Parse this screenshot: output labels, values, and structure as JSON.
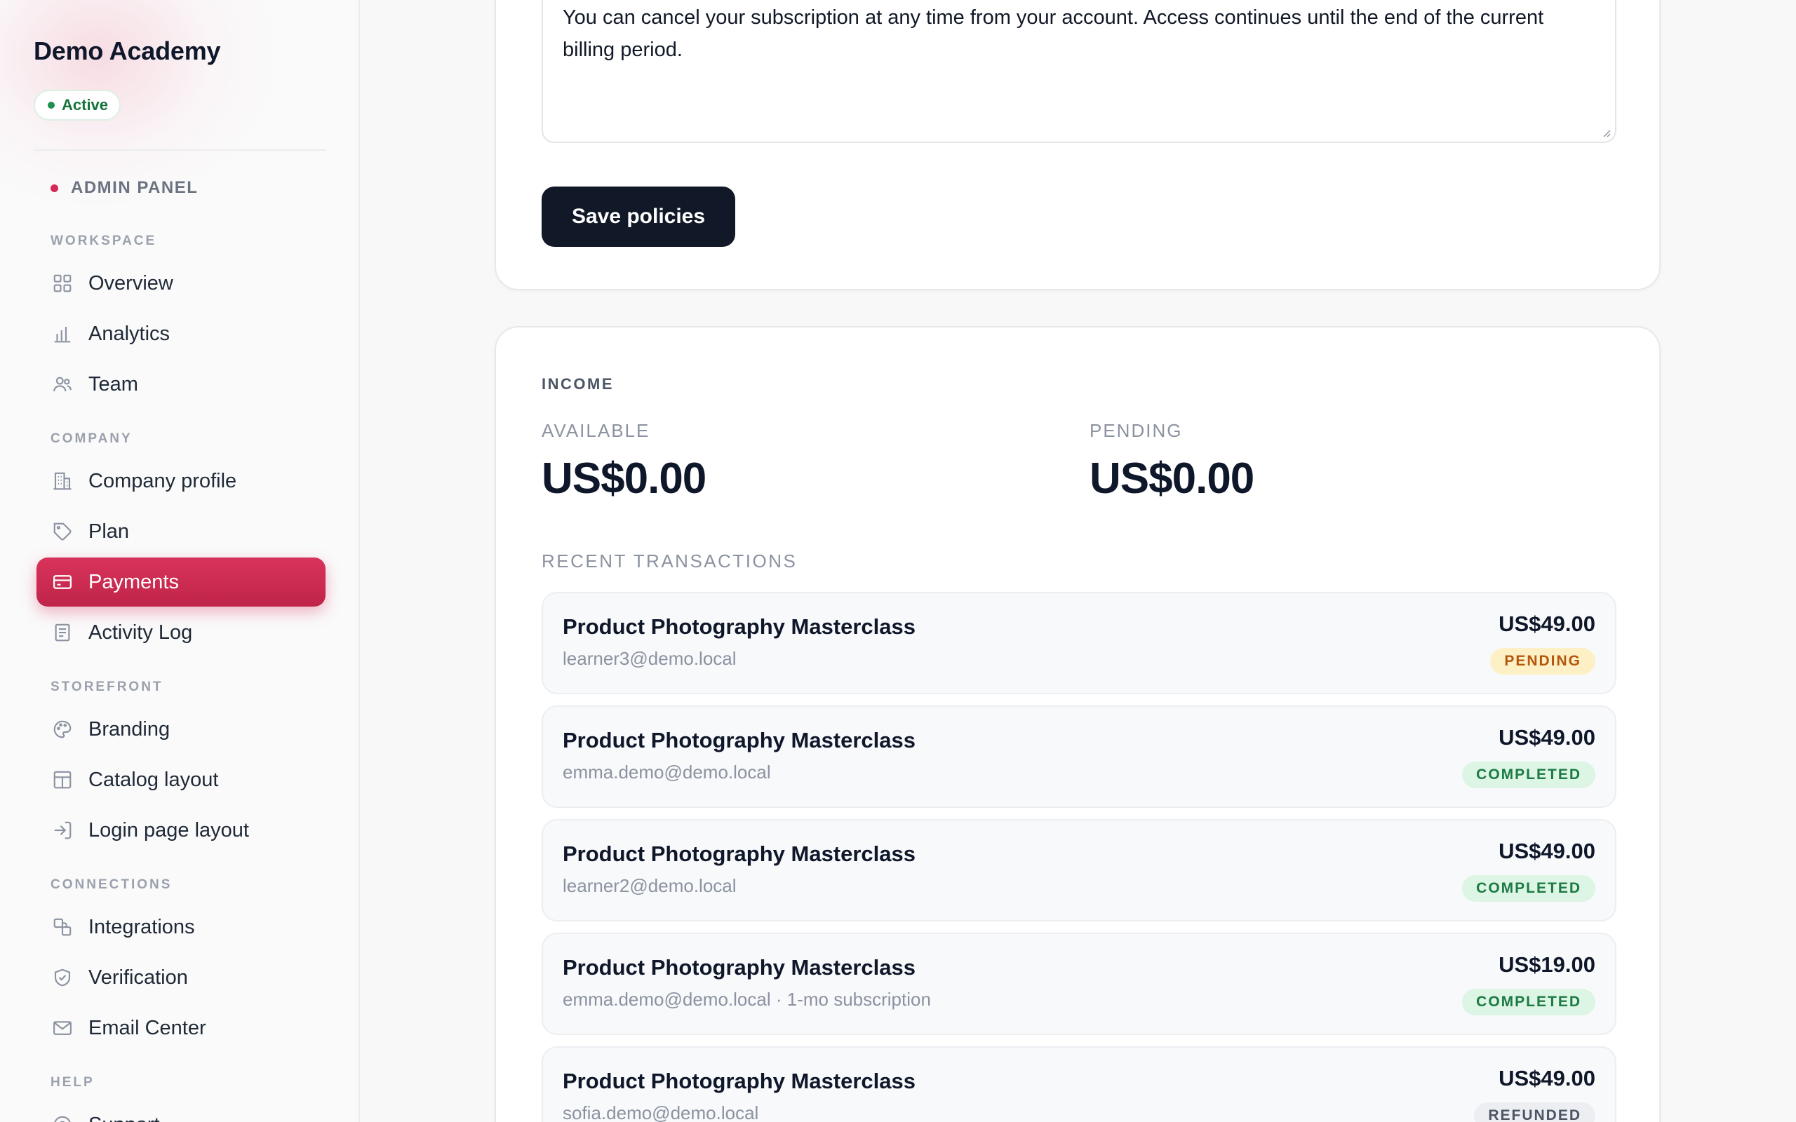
{
  "sidebar": {
    "brand": "Demo Academy",
    "status": "Active",
    "panel_label": "ADMIN PANEL",
    "sections": {
      "workspace": "WORKSPACE",
      "company": "COMPANY",
      "storefront": "STOREFRONT",
      "connections": "CONNECTIONS",
      "help": "HELP"
    },
    "items": {
      "overview": {
        "label": "Overview",
        "icon": "grid-icon"
      },
      "analytics": {
        "label": "Analytics",
        "icon": "bar-chart-icon"
      },
      "team": {
        "label": "Team",
        "icon": "users-icon"
      },
      "company_profile": {
        "label": "Company profile",
        "icon": "building-icon"
      },
      "plan": {
        "label": "Plan",
        "icon": "tag-icon"
      },
      "payments": {
        "label": "Payments",
        "icon": "credit-card-icon",
        "active": true
      },
      "activity_log": {
        "label": "Activity Log",
        "icon": "document-icon"
      },
      "branding": {
        "label": "Branding",
        "icon": "palette-icon"
      },
      "catalog_layout": {
        "label": "Catalog layout",
        "icon": "layout-icon"
      },
      "login_page_layout": {
        "label": "Login page layout",
        "icon": "login-icon"
      },
      "integrations": {
        "label": "Integrations",
        "icon": "link-icon"
      },
      "verification": {
        "label": "Verification",
        "icon": "shield-check-icon"
      },
      "email_center": {
        "label": "Email Center",
        "icon": "mail-icon"
      },
      "support": {
        "label": "Support",
        "icon": "help-icon"
      }
    }
  },
  "policies": {
    "cancellation_text": "You can cancel your subscription at any time from your account. Access continues until the end of the current billing period.",
    "save_label": "Save policies"
  },
  "income": {
    "title": "INCOME",
    "available_label": "AVAILABLE",
    "available_value": "US$0.00",
    "pending_label": "PENDING",
    "pending_value": "US$0.00",
    "recent_label": "RECENT TRANSACTIONS",
    "transactions": [
      {
        "title": "Product Photography Masterclass",
        "subtitle": "learner3@demo.local",
        "amount": "US$49.00",
        "status": "PENDING"
      },
      {
        "title": "Product Photography Masterclass",
        "subtitle": "emma.demo@demo.local",
        "amount": "US$49.00",
        "status": "COMPLETED"
      },
      {
        "title": "Product Photography Masterclass",
        "subtitle": "learner2@demo.local",
        "amount": "US$49.00",
        "status": "COMPLETED"
      },
      {
        "title": "Product Photography Masterclass",
        "subtitle": "emma.demo@demo.local · 1-mo subscription",
        "amount": "US$19.00",
        "status": "COMPLETED"
      },
      {
        "title": "Product Photography Masterclass",
        "subtitle": "sofia.demo@demo.local",
        "amount": "US$49.00",
        "status": "REFUNDED"
      }
    ]
  },
  "colors": {
    "accent": "#d32a56",
    "primary_button": "#111827",
    "pending": "#b4570c",
    "completed": "#1c7a43"
  }
}
